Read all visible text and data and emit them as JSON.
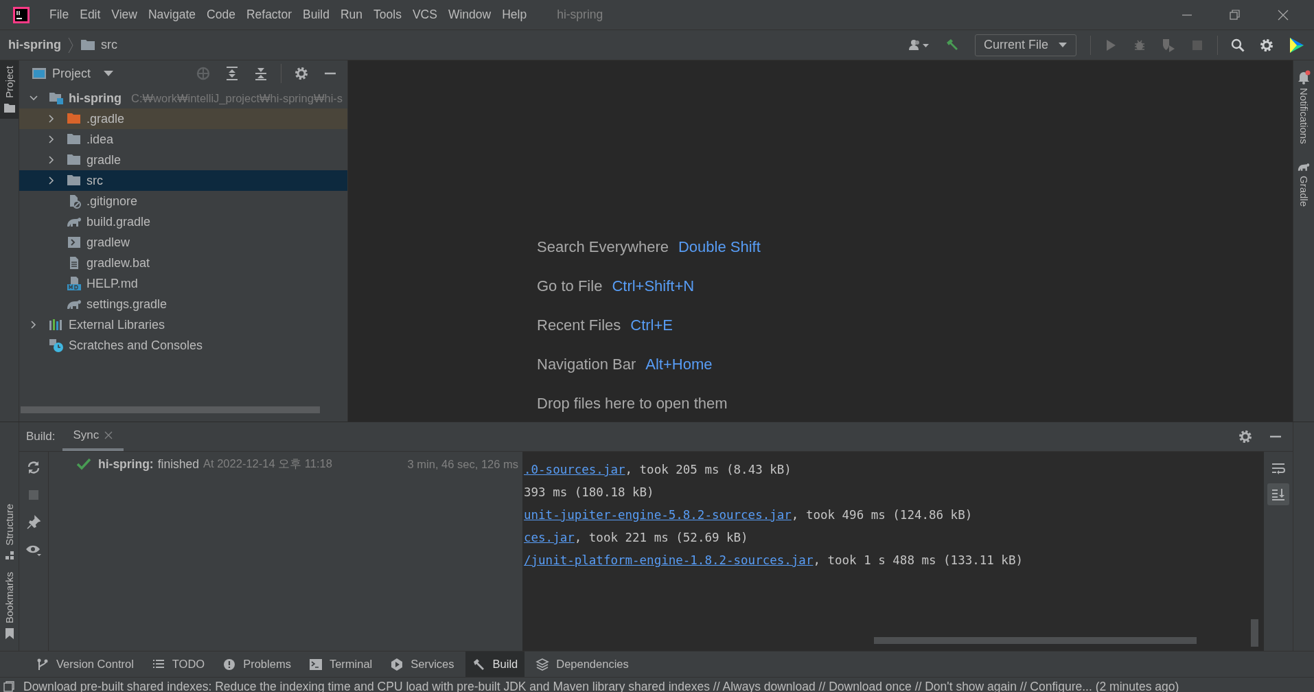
{
  "window": {
    "title": "hi-spring"
  },
  "menu": [
    "File",
    "Edit",
    "View",
    "Navigate",
    "Code",
    "Refactor",
    "Build",
    "Run",
    "Tools",
    "VCS",
    "Window",
    "Help"
  ],
  "breadcrumb": [
    {
      "label": "hi-spring",
      "kind": "project"
    },
    {
      "label": "src",
      "kind": "folder"
    }
  ],
  "toolbar": {
    "run_config": "Current File",
    "tools": [
      {
        "kind": "user",
        "disabled": false
      },
      {
        "kind": "build",
        "disabled": false
      },
      {
        "kind": "run",
        "disabled": true
      },
      {
        "kind": "debug",
        "disabled": true
      },
      {
        "kind": "coverage",
        "disabled": true
      },
      {
        "kind": "stop",
        "disabled": true
      },
      {
        "kind": "search",
        "disabled": false
      },
      {
        "kind": "settings",
        "disabled": false
      }
    ]
  },
  "left_stripe": {
    "top": [
      {
        "label": "Project",
        "selected": true
      }
    ],
    "bottom": [
      {
        "label": "Structure",
        "selected": false
      },
      {
        "label": "Bookmarks",
        "selected": false
      }
    ]
  },
  "right_stripe": [
    {
      "label": "Notifications",
      "kind": "bell"
    },
    {
      "label": "Gradle",
      "kind": "elephant"
    }
  ],
  "project_panel": {
    "title": "Project",
    "tree": [
      {
        "label": "hi-spring",
        "kind": "module",
        "note": "C:₩work₩intelliJ_project₩hi-spring₩hi-s",
        "expanded": true,
        "selected": false,
        "excluded": false,
        "children": [
          {
            "label": ".gradle",
            "kind": "folder",
            "expanded": false,
            "selected": false,
            "excluded": true
          },
          {
            "label": ".idea",
            "kind": "folder",
            "expanded": false,
            "selected": false,
            "excluded": false
          },
          {
            "label": "gradle",
            "kind": "folder",
            "expanded": false,
            "selected": false,
            "excluded": false
          },
          {
            "label": "src",
            "kind": "folder",
            "expanded": false,
            "selected": true,
            "excluded": false
          },
          {
            "label": ".gitignore",
            "kind": "ignore",
            "selected": false,
            "excluded": false
          },
          {
            "label": "build.gradle",
            "kind": "gradle",
            "selected": false,
            "excluded": false
          },
          {
            "label": "gradlew",
            "kind": "script",
            "selected": false,
            "excluded": false
          },
          {
            "label": "gradlew.bat",
            "kind": "text",
            "selected": false,
            "excluded": false
          },
          {
            "label": "HELP.md",
            "kind": "markdown",
            "selected": false,
            "excluded": false
          },
          {
            "label": "settings.gradle",
            "kind": "gradle",
            "selected": false,
            "excluded": false
          }
        ]
      },
      {
        "label": "External Libraries",
        "kind": "library",
        "expanded": false,
        "selected": false,
        "excluded": false
      },
      {
        "label": "Scratches and Consoles",
        "kind": "scratches",
        "selected": false,
        "excluded": false
      }
    ]
  },
  "editor_hints": [
    {
      "action": "Search Everywhere",
      "shortcut": "Double Shift"
    },
    {
      "action": "Go to File",
      "shortcut": "Ctrl+Shift+N"
    },
    {
      "action": "Recent Files",
      "shortcut": "Ctrl+E"
    },
    {
      "action": "Navigation Bar",
      "shortcut": "Alt+Home"
    },
    {
      "action": "Drop files here to open them"
    }
  ],
  "build_panel": {
    "label": "Build:",
    "tabs": [
      {
        "label": "Sync",
        "selected": true
      }
    ],
    "result": {
      "name": "hi-spring:",
      "status": "finished",
      "time": "At 2022-12-14 오후 11:18",
      "duration": "3 min, 46 sec, 126 ms",
      "success": true
    },
    "console": [
      {
        "link": ".0-sources.jar",
        "text": ", took 205 ms (8.43 kB)"
      },
      {
        "text": "393 ms (180.18 kB)"
      },
      {
        "link": "unit-jupiter-engine-5.8.2-sources.jar",
        "text": ", took 496 ms (124.86 kB)"
      },
      {
        "link": "ces.jar",
        "text": ", took 221 ms (52.69 kB)"
      },
      {
        "link": "/junit-platform-engine-1.8.2-sources.jar",
        "text": ", took 1 s 488 ms (133.11 kB)"
      }
    ],
    "console_tools": [
      {
        "kind": "wrap",
        "on": false
      },
      {
        "kind": "scroll-end",
        "on": true
      }
    ]
  },
  "tool_tabs": [
    {
      "label": "Version Control",
      "kind": "vcs",
      "selected": false
    },
    {
      "label": "TODO",
      "kind": "todo",
      "selected": false
    },
    {
      "label": "Problems",
      "kind": "problems",
      "selected": false
    },
    {
      "label": "Terminal",
      "kind": "terminal",
      "selected": false
    },
    {
      "label": "Services",
      "kind": "services",
      "selected": false
    },
    {
      "label": "Build",
      "kind": "build",
      "selected": true
    },
    {
      "label": "Dependencies",
      "kind": "deps",
      "selected": false
    }
  ],
  "status_bar": "Download pre-built shared indexes: Reduce the indexing time and CPU load with pre-built JDK and Maven library shared indexes // Always download // Download once // Don't show again // Configure... (2 minutes ago)"
}
